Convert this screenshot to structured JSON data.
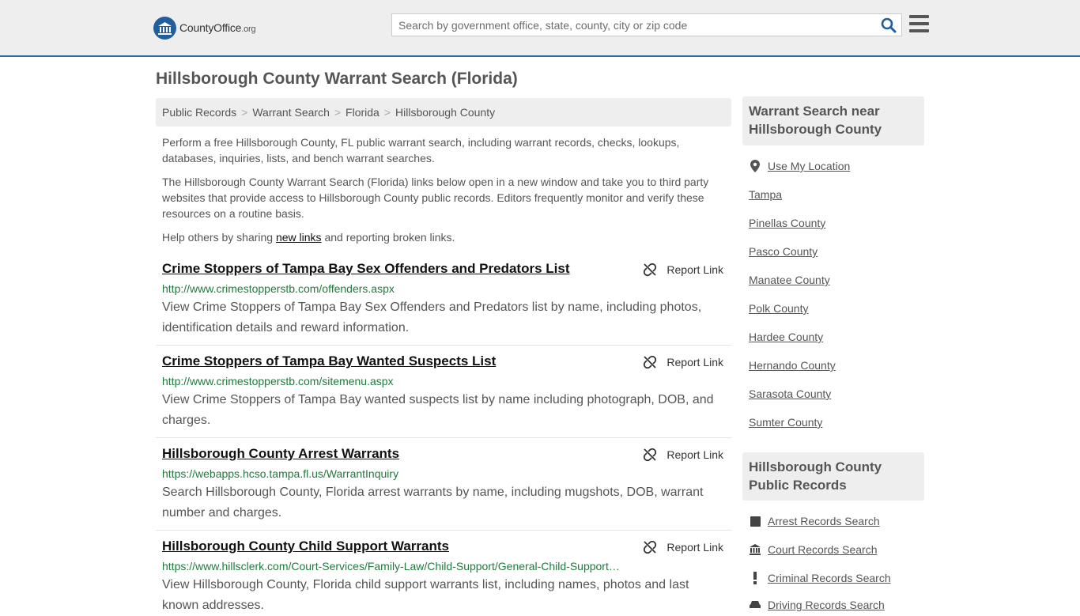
{
  "header": {
    "logo_text_main": "CountyOffice",
    "logo_text_tld": ".org",
    "search_placeholder": "Search by government office, state, county, city or zip code"
  },
  "page": {
    "title": "Hillsborough County Warrant Search (Florida)"
  },
  "breadcrumb": [
    "Public Records",
    "Warrant Search",
    "Florida",
    "Hillsborough County"
  ],
  "intro": {
    "p1": "Perform a free Hillsborough County, FL public warrant search, including warrant records, checks, lookups, databases, inquiries, lists, and bench warrant searches.",
    "p2": "The Hillsborough County Warrant Search (Florida) links below open in a new window and take you to third party websites that provide access to Hillsborough County public records. Editors frequently monitor and verify these resources on a routine basis.",
    "p3_before": "Help others by sharing ",
    "p3_link": "new links",
    "p3_after": " and reporting broken links."
  },
  "report_label": "Report Link",
  "results": [
    {
      "title": "Crime Stoppers of Tampa Bay Sex Offenders and Predators List",
      "url": "http://www.crimestopperstb.com/offenders.aspx",
      "desc": "View Crime Stoppers of Tampa Bay Sex Offenders and Predators list by name, including photos, identification details and reward information."
    },
    {
      "title": "Crime Stoppers of Tampa Bay Wanted Suspects List",
      "url": "http://www.crimestopperstb.com/sitemenu.aspx",
      "desc": "View Crime Stoppers of Tampa Bay wanted suspects list by name including photograph, DOB, and charges."
    },
    {
      "title": "Hillsborough County Arrest Warrants",
      "url": "https://webapps.hcso.tampa.fl.us/WarrantInquiry",
      "desc": "Search Hillsborough County, Florida arrest warrants by name, including mugshots, DOB, warrant number and charges."
    },
    {
      "title": "Hillsborough County Child Support Warrants",
      "url": "https://www.hillsclerk.com/Court-Services/Family-Law/Child-Support/General-Child-Support…",
      "desc": "View Hillsborough County, Florida child support warrants list, including names, photos and last known addresses."
    }
  ],
  "sidebar": {
    "nearby_heading": "Warrant Search near Hillsborough County",
    "use_location": "Use My Location",
    "nearby": [
      "Tampa",
      "Pinellas County",
      "Pasco County",
      "Manatee County",
      "Polk County",
      "Hardee County",
      "Hernando County",
      "Sarasota County",
      "Sumter County"
    ],
    "records_heading": "Hillsborough County Public Records",
    "records": [
      {
        "label": "Arrest Records Search",
        "icon": "square-icon"
      },
      {
        "label": "Court Records Search",
        "icon": "courthouse-icon"
      },
      {
        "label": "Criminal Records Search",
        "icon": "exclamation-icon"
      },
      {
        "label": "Driving Records Search",
        "icon": "car-icon"
      }
    ]
  },
  "colors": {
    "header_bg": "#eeeeee",
    "header_border": "#2d6aa8",
    "link_url_green": "#217a3c",
    "search_icon_blue": "#1f5f9e"
  }
}
